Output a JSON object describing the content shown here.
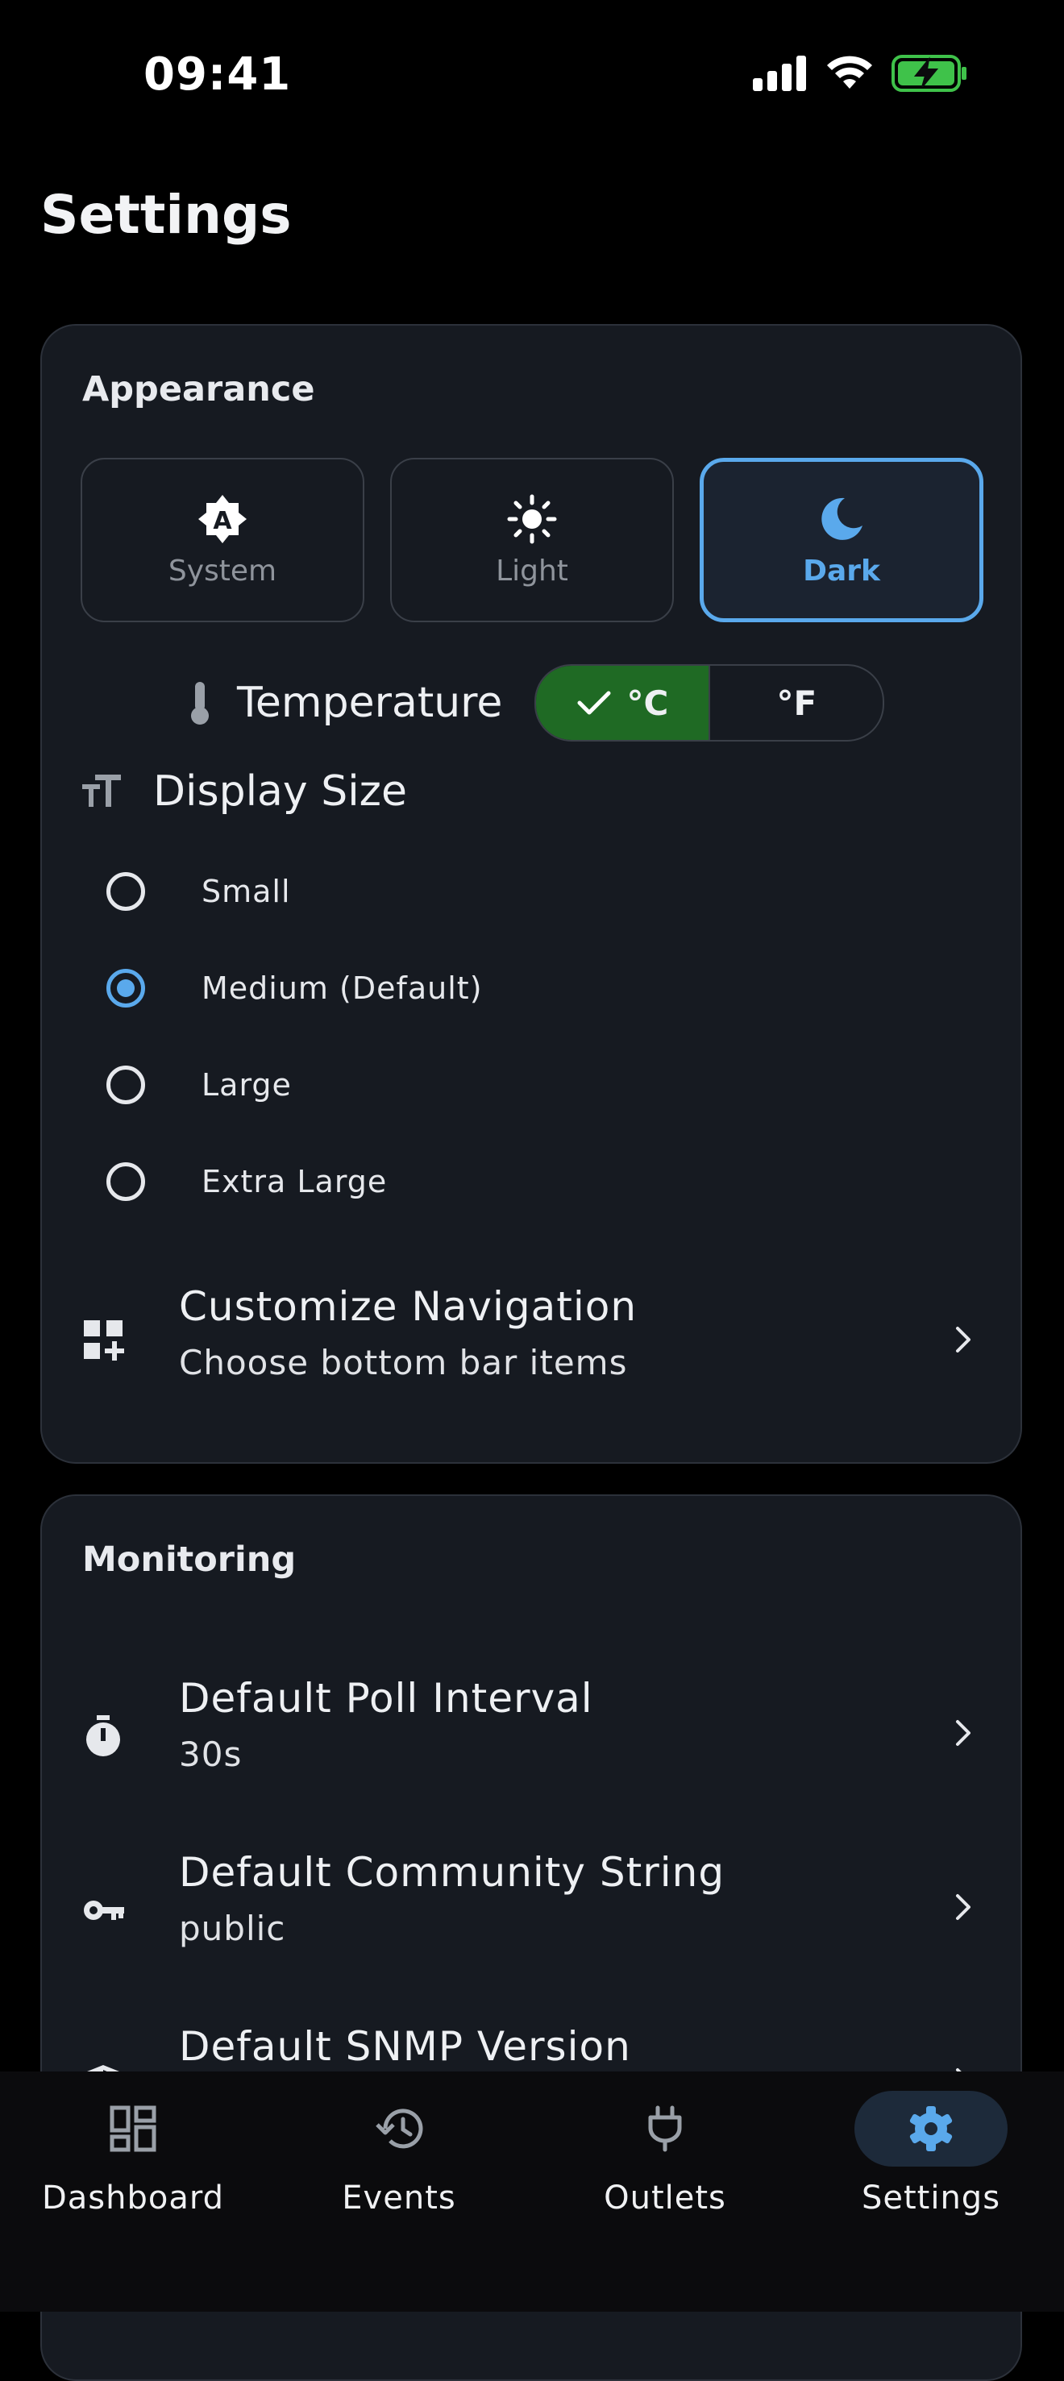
{
  "status_bar": {
    "time": "09:41"
  },
  "page": {
    "title": "Settings"
  },
  "appearance": {
    "title": "Appearance",
    "themes": [
      {
        "label": "System",
        "icon": "brightness-auto-icon",
        "selected": false
      },
      {
        "label": "Light",
        "icon": "sun-icon",
        "selected": false
      },
      {
        "label": "Dark",
        "icon": "moon-icon",
        "selected": true
      }
    ],
    "temperature": {
      "label": "Temperature",
      "options": [
        {
          "label": "°C",
          "selected": true
        },
        {
          "label": "°F",
          "selected": false
        }
      ]
    },
    "display_size": {
      "label": "Display Size",
      "options": [
        {
          "label": "Small",
          "selected": false
        },
        {
          "label": "Medium (Default)",
          "selected": true
        },
        {
          "label": "Large",
          "selected": false
        },
        {
          "label": "Extra Large",
          "selected": false
        }
      ]
    },
    "customize_nav": {
      "title": "Customize Navigation",
      "subtitle": "Choose bottom bar items"
    }
  },
  "monitoring": {
    "title": "Monitoring",
    "items": [
      {
        "title": "Default Poll Interval",
        "value": "30s",
        "icon": "timer-icon"
      },
      {
        "title": "Default Community String",
        "value": "public",
        "icon": "key-icon"
      },
      {
        "title": "Default SNMP Version",
        "value": "",
        "icon": "shield-icon"
      }
    ]
  },
  "bottom_nav": {
    "items": [
      {
        "label": "Dashboard",
        "icon": "dashboard-icon",
        "active": false
      },
      {
        "label": "Events",
        "icon": "history-icon",
        "active": false
      },
      {
        "label": "Outlets",
        "icon": "plug-icon",
        "active": false
      },
      {
        "label": "Settings",
        "icon": "gear-icon",
        "active": true
      }
    ]
  },
  "colors": {
    "accent": "#5aa9ec",
    "toggle_on": "#1f6a24",
    "card": "#161a21",
    "battery": "#3fc24a"
  }
}
